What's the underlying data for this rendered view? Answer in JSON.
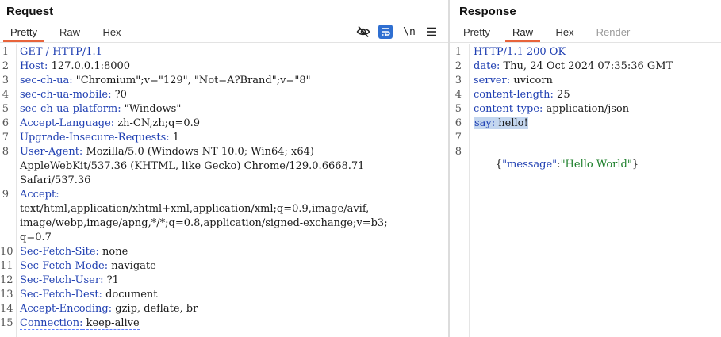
{
  "request": {
    "title": "Request",
    "tabs": [
      "Pretty",
      "Raw",
      "Hex"
    ],
    "toolbar": {
      "newline_label": "\\n"
    },
    "lines": [
      {
        "n": "1",
        "name": "GET / HTTP/1.1",
        "value": ""
      },
      {
        "n": "2",
        "name": "Host:",
        "value": " 127.0.0.1:8000"
      },
      {
        "n": "3",
        "name": "sec-ch-ua:",
        "value": " \"Chromium\";v=\"129\", \"Not=A?Brand\";v=\"8\""
      },
      {
        "n": "4",
        "name": "sec-ch-ua-mobile:",
        "value": " ?0"
      },
      {
        "n": "5",
        "name": "sec-ch-ua-platform:",
        "value": " \"Windows\""
      },
      {
        "n": "6",
        "name": "Accept-Language:",
        "value": " zh-CN,zh;q=0.9"
      },
      {
        "n": "7",
        "name": "Upgrade-Insecure-Requests:",
        "value": " 1"
      },
      {
        "n": "8",
        "name": "User-Agent:",
        "value": " Mozilla/5.0 (Windows NT 10.0; Win64; x64)"
      },
      {
        "n": "",
        "name": "",
        "value": "AppleWebKit/537.36 (KHTML, like Gecko) Chrome/129.0.6668.71"
      },
      {
        "n": "",
        "name": "",
        "value": "Safari/537.36"
      },
      {
        "n": "9",
        "name": "Accept:",
        "value": ""
      },
      {
        "n": "",
        "name": "",
        "value": "text/html,application/xhtml+xml,application/xml;q=0.9,image/avif,"
      },
      {
        "n": "",
        "name": "",
        "value": "image/webp,image/apng,*/*;q=0.8,application/signed-exchange;v=b3;"
      },
      {
        "n": "",
        "name": "",
        "value": "q=0.7"
      },
      {
        "n": "10",
        "name": "Sec-Fetch-Site:",
        "value": " none"
      },
      {
        "n": "11",
        "name": "Sec-Fetch-Mode:",
        "value": " navigate"
      },
      {
        "n": "12",
        "name": "Sec-Fetch-User:",
        "value": " ?1"
      },
      {
        "n": "13",
        "name": "Sec-Fetch-Dest:",
        "value": " document"
      },
      {
        "n": "14",
        "name": "Accept-Encoding:",
        "value": " gzip, deflate, br"
      },
      {
        "n": "15",
        "name": "Connection:",
        "value": " keep-alive"
      }
    ]
  },
  "response": {
    "title": "Response",
    "tabs": [
      "Pretty",
      "Raw",
      "Hex",
      "Render"
    ],
    "lines": [
      {
        "n": "1",
        "name": "HTTP/1.1 200 OK",
        "value": ""
      },
      {
        "n": "2",
        "name": "date:",
        "value": " Thu, 24 Oct 2024 07:35:36 GMT"
      },
      {
        "n": "3",
        "name": "server:",
        "value": " uvicorn"
      },
      {
        "n": "4",
        "name": "content-length:",
        "value": " 25"
      },
      {
        "n": "5",
        "name": "content-type:",
        "value": " application/json"
      },
      {
        "n": "6",
        "name": "say:",
        "value": " hello!"
      },
      {
        "n": "7",
        "name": "",
        "value": ""
      },
      {
        "n": "8",
        "name": "",
        "value": ""
      }
    ],
    "body_json": {
      "open": "{",
      "key": "\"message\"",
      "colon": ":",
      "val": "\"Hello World\"",
      "close": "}"
    }
  },
  "colors": {
    "accent": "#e8643b",
    "header_name": "#1f3fb2",
    "string": "#1c7f2a",
    "selection": "#c3d6ef",
    "wrap_button": "#2f6fd1"
  }
}
